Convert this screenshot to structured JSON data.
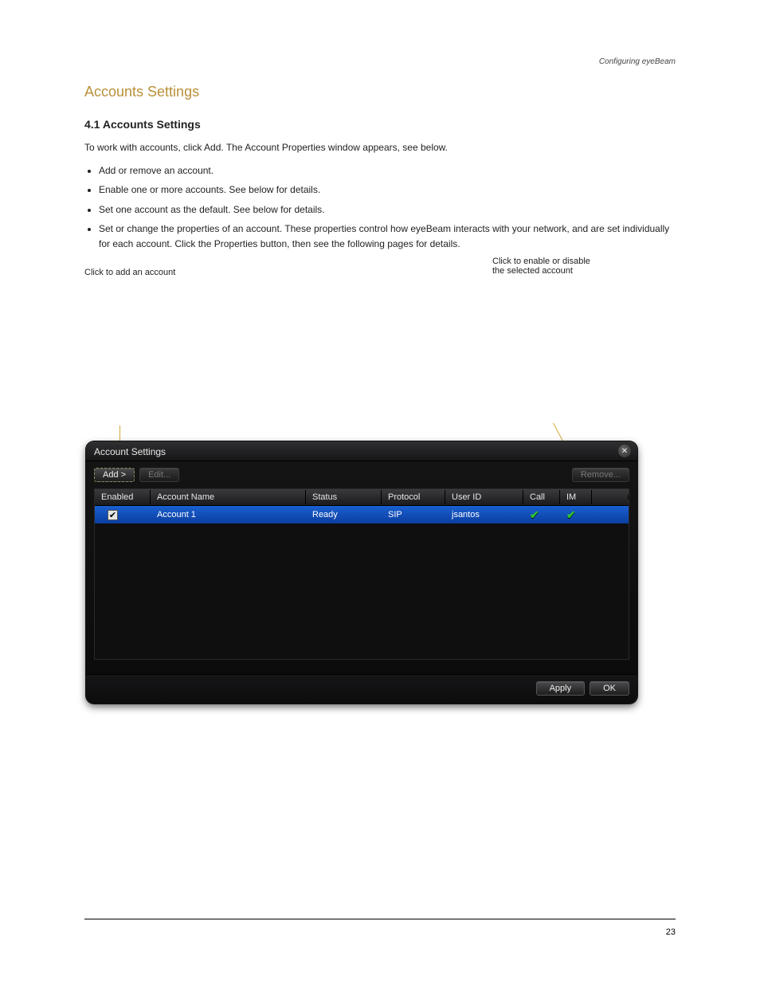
{
  "running_header": "Configuring eyeBeam",
  "chapter_title": "Accounts Settings",
  "section_title": "4.1 Accounts Settings",
  "para1": "To work with accounts, click Add. The Account Properties window appears, see below.",
  "bullets": [
    "Add or remove an account.",
    "Enable one or more accounts. See below for details.",
    "Set one account as the default. See below for details.",
    "Set or change the properties of an account. These properties control how eyeBeam interacts with your network, and are set individually for each account. Click the Properties button, then see the following pages for details."
  ],
  "callout_left": "Click to add an account",
  "callout_right": "Click to enable or disable\nthe selected account",
  "dialog": {
    "title": "Account Settings",
    "add_btn": "Add >",
    "edit_btn": "Edit...",
    "remove_btn": "Remove...",
    "apply_btn": "Apply",
    "ok_btn": "OK",
    "columns": [
      "Enabled",
      "Account Name",
      "Status",
      "Protocol",
      "User ID",
      "Call",
      "IM"
    ],
    "rows": [
      {
        "enabled": true,
        "account_name": "Account 1",
        "status": "Ready",
        "protocol": "SIP",
        "user_id": "jsantos",
        "call": true,
        "im": true
      }
    ]
  },
  "page_number": "23"
}
